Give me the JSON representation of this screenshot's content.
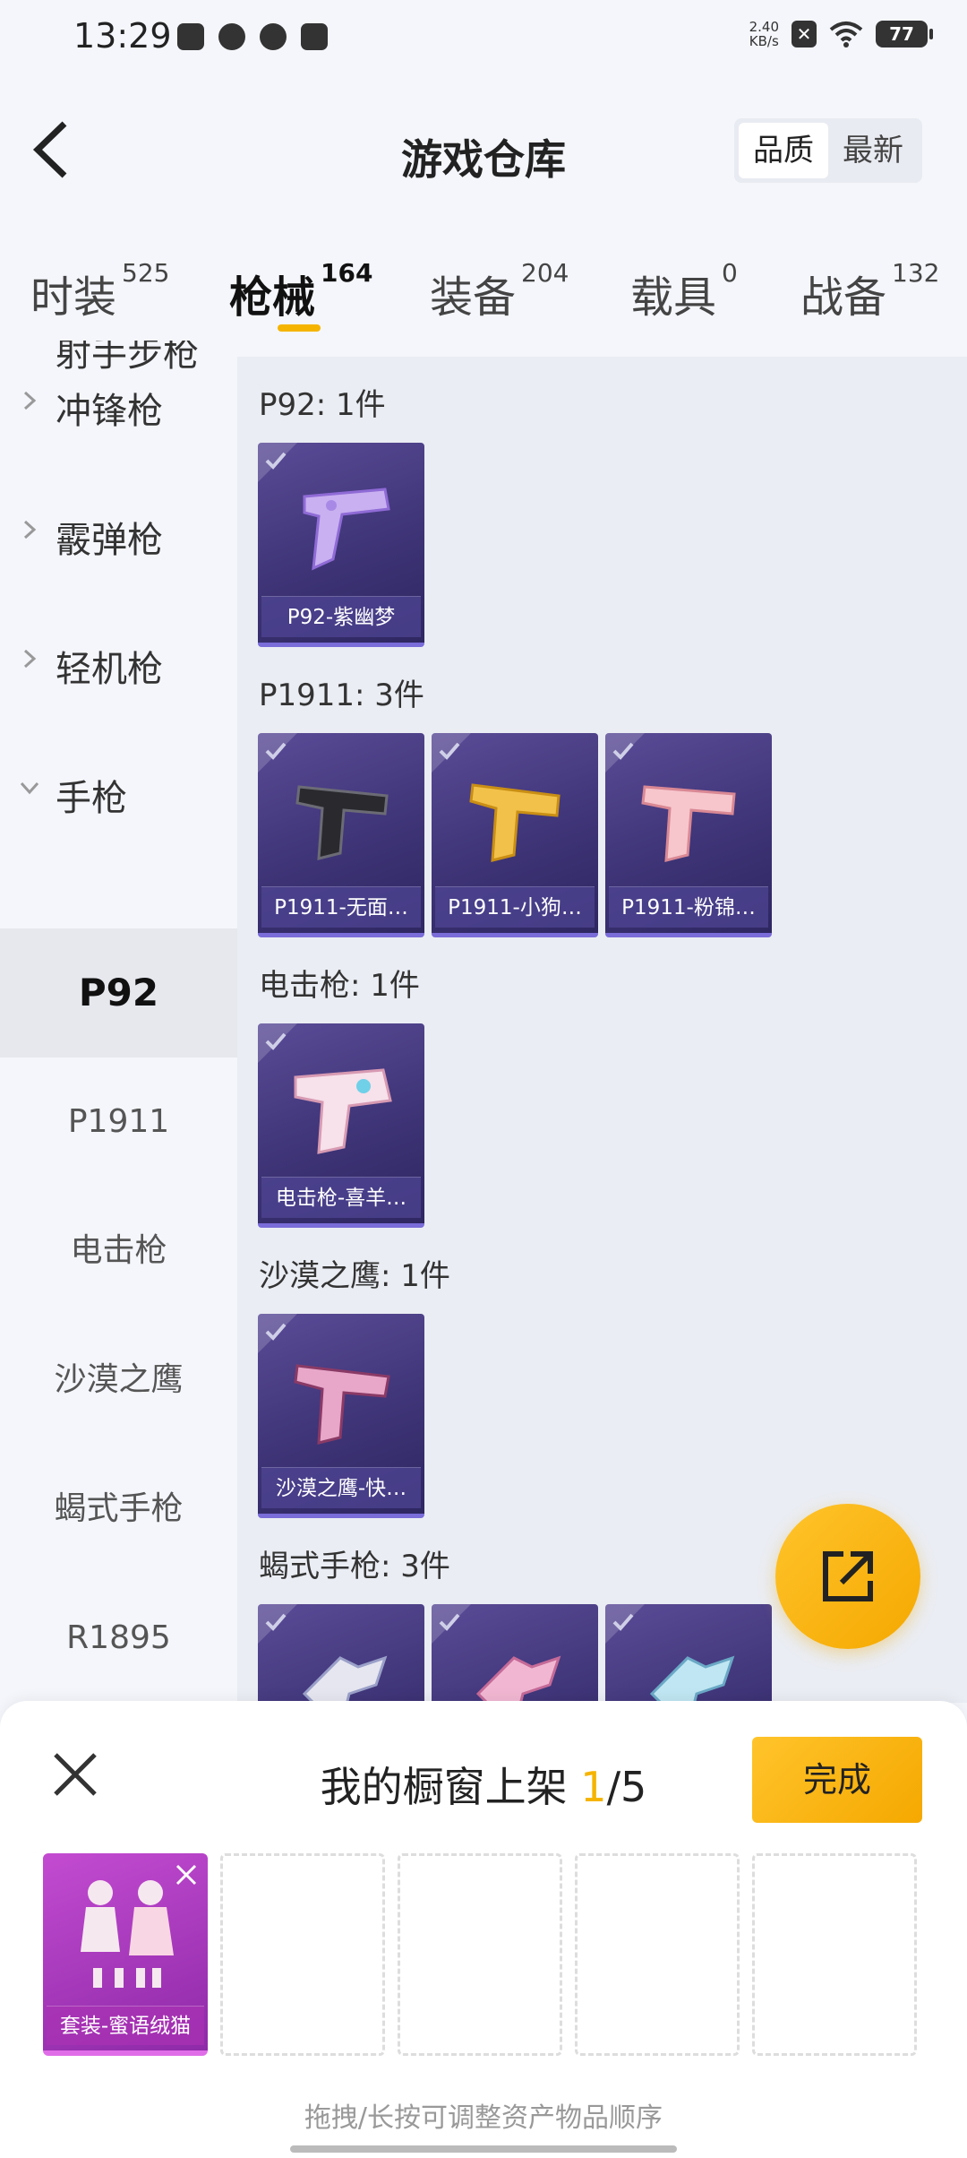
{
  "status_bar": {
    "time": "13:29",
    "net_speed_value": "2.40",
    "net_speed_unit": "KB/s",
    "battery": "77"
  },
  "header": {
    "title": "游戏仓库",
    "sort_options": [
      "品质",
      "最新"
    ],
    "sort_active": "品质"
  },
  "tabs": [
    {
      "label": "时装",
      "count": "525"
    },
    {
      "label": "枪械",
      "count": "164"
    },
    {
      "label": "装备",
      "count": "204"
    },
    {
      "label": "载具",
      "count": "0"
    },
    {
      "label": "战备",
      "count": "132"
    }
  ],
  "active_tab": "枪械",
  "accent_color": "#f5b400",
  "sidemenu": {
    "cut_top_label": "射手步枪",
    "categories": [
      "冲锋枪",
      "霰弹枪",
      "轻机枪",
      "手枪"
    ],
    "expanded": "手枪",
    "sub_items": [
      "P92",
      "P1911",
      "电击枪",
      "沙漠之鹰",
      "蝎式手枪",
      "R1895"
    ],
    "active_sub": "P92"
  },
  "groups": [
    {
      "title": "P92: 1件",
      "items": [
        "P92-紫幽梦"
      ]
    },
    {
      "title": "P1911: 3件",
      "items": [
        "P1911-无面…",
        "P1911-小狗…",
        "P1911-粉锦…"
      ]
    },
    {
      "title": "电击枪: 1件",
      "items": [
        "电击枪-喜羊…"
      ]
    },
    {
      "title": "沙漠之鹰: 1件",
      "items": [
        "沙漠之鹰-快…"
      ]
    },
    {
      "title": "蝎式手枪: 3件",
      "items": [
        "",
        "",
        ""
      ]
    }
  ],
  "fab": {
    "icon": "share-icon"
  },
  "sheet": {
    "title_prefix": "我的橱窗上架 ",
    "count_current": "1",
    "count_total": "/5",
    "done_label": "完成",
    "slots": [
      "套装-蜜语绒猫",
      "",
      "",
      "",
      ""
    ],
    "hint": "拖拽/长按可调整资产物品顺序"
  }
}
